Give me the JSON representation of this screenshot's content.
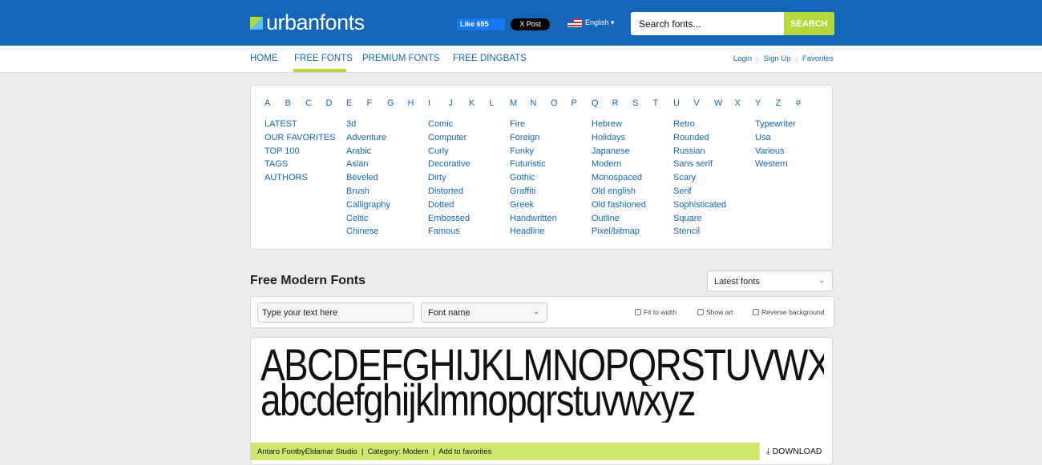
{
  "header": {
    "logo": "urbanfonts",
    "fb_like": "Like 695",
    "x_post": "X Post",
    "language": "English ▾",
    "search_placeholder": "Search fonts...",
    "search_button": "SEARCH"
  },
  "nav": {
    "items": [
      "HOME",
      "FREE FONTS",
      "PREMIUM FONTS",
      "FREE DINGBATS"
    ],
    "login": "Login",
    "signup": "Sign Up",
    "favorites": "Favorites"
  },
  "letters": [
    "A",
    "B",
    "C",
    "D",
    "E",
    "F",
    "G",
    "H",
    "I",
    "J",
    "K",
    "L",
    "M",
    "N",
    "O",
    "P",
    "Q",
    "R",
    "S",
    "T",
    "U",
    "V",
    "W",
    "X",
    "Y",
    "Z",
    "#"
  ],
  "categories": [
    [
      "LATEST",
      "OUR FAVORITES",
      "TOP 100",
      "TAGS",
      "AUTHORS"
    ],
    [
      "3d",
      "Adventure",
      "Arabic",
      "Asian",
      "Beveled",
      "Brush",
      "Calligraphy",
      "Celtic",
      "Chinese"
    ],
    [
      "Comic",
      "Computer",
      "Curly",
      "Decorative",
      "Dirty",
      "Distorted",
      "Dotted",
      "Embossed",
      "Famous"
    ],
    [
      "Fire",
      "Foreign",
      "Funky",
      "Futuristic",
      "Gothic",
      "Graffiti",
      "Greek",
      "Handwritten",
      "Headline"
    ],
    [
      "Hebrew",
      "Holidays",
      "Japanese",
      "Modern",
      "Monospaced",
      "Old english",
      "Old fashioned",
      "Outline",
      "Pixel/bitmap"
    ],
    [
      "Retro",
      "Rounded",
      "Russian",
      "Sans serif",
      "Scary",
      "Serif",
      "Sophisticated",
      "Square",
      "Stencil"
    ],
    [
      "Typewriter",
      "Usa",
      "Various",
      "Western"
    ]
  ],
  "main": {
    "title": "Free Modern Fonts",
    "sort": "Latest fonts",
    "text_placeholder": "Type your text here",
    "font_name": "Font name",
    "fit": "Fit to width",
    "show_art": "Show art",
    "reverse": "Reverse background"
  },
  "font": {
    "upper": "ABCDEFGHIJKLMNOPQRSTUVWXYZ",
    "lower": "abcdefghijklmnopqrstuvwxyz",
    "name": "Antaro FontbyEldamar Studio",
    "category": "Category: Modern",
    "fav": "Add to favorites",
    "download": "DOWNLOAD"
  }
}
